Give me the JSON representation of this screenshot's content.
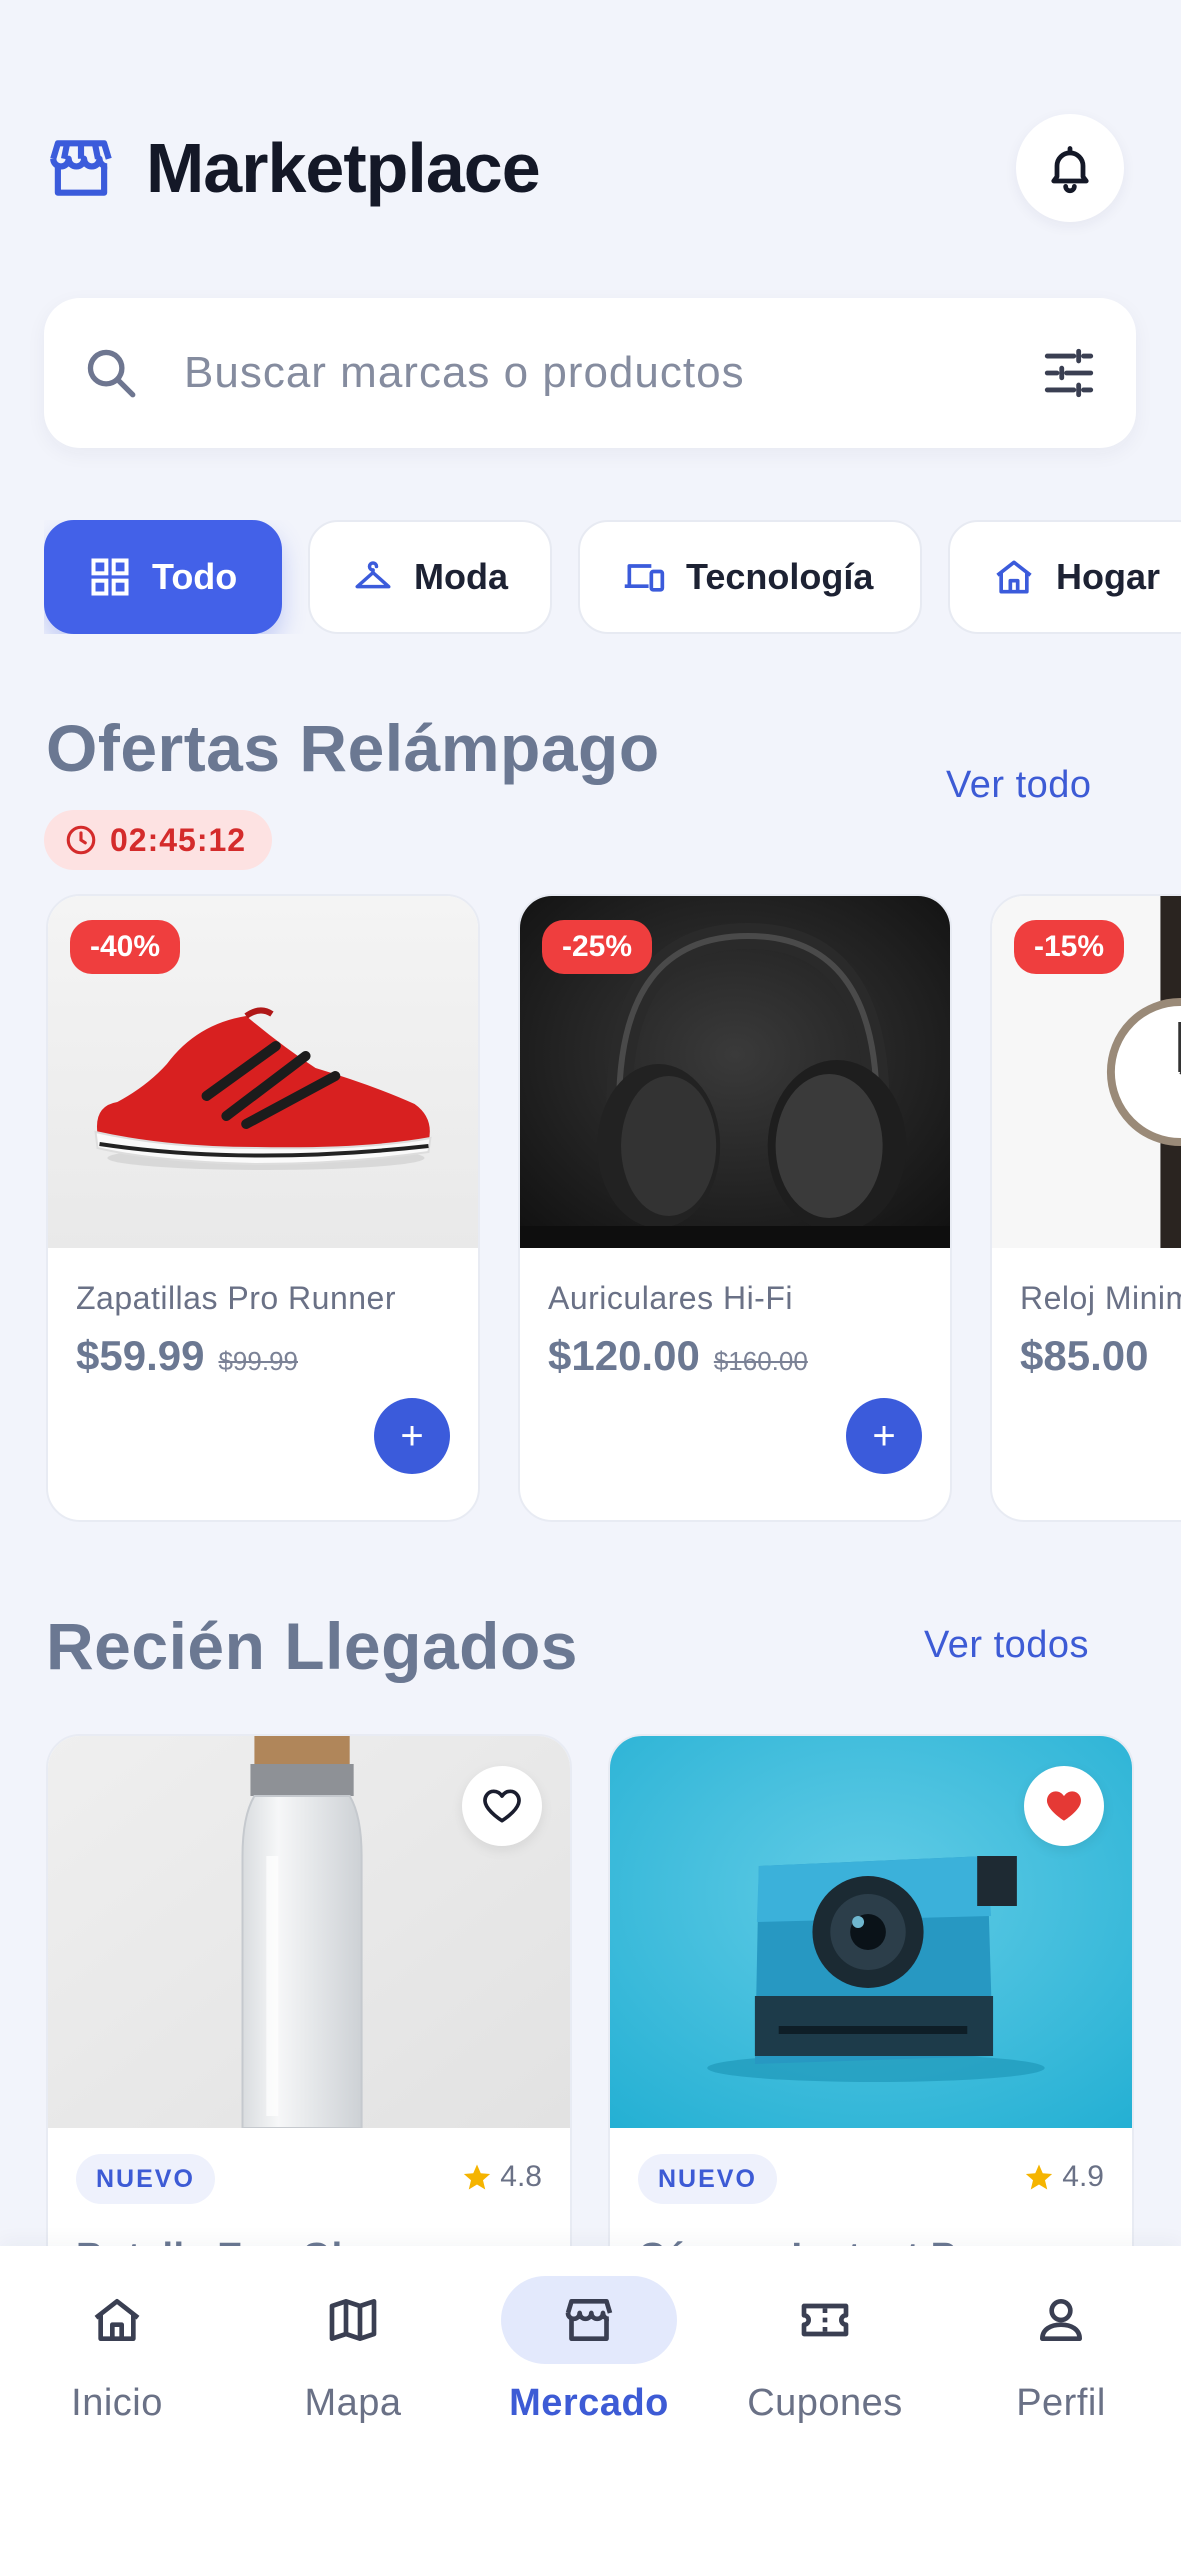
{
  "header": {
    "title": "Marketplace",
    "store_icon": "storefront-icon",
    "notifications_icon": "bell-icon"
  },
  "search": {
    "placeholder": "Buscar marcas o productos",
    "search_icon": "search-icon",
    "filter_icon": "sliders-icon"
  },
  "categories": [
    {
      "label": "Todo",
      "icon": "grid-icon",
      "active": true
    },
    {
      "label": "Moda",
      "icon": "hanger-icon",
      "active": false
    },
    {
      "label": "Tecnología",
      "icon": "devices-icon",
      "active": false
    },
    {
      "label": "Hogar",
      "icon": "home-icon",
      "active": false
    }
  ],
  "flash": {
    "title": "Ofertas Relámpago",
    "see_all": "Ver todo",
    "timer": "02:45:12",
    "items": [
      {
        "discount": "-40%",
        "name": "Zapatillas Pro Runner",
        "price": "$59.99",
        "old_price": "$99.99"
      },
      {
        "discount": "-25%",
        "name": "Auriculares Hi-Fi",
        "price": "$120.00",
        "old_price": "$160.00"
      },
      {
        "discount": "-15%",
        "name": "Reloj Minimalista",
        "price": "$85.00",
        "old_price": ""
      }
    ],
    "add_label": "+"
  },
  "arrivals": {
    "title": "Recién Llegados",
    "see_all": "Ver todos",
    "items": [
      {
        "badge": "NUEVO",
        "rating": "4.8",
        "name": "Botella Eco-Glass",
        "favorite": false
      },
      {
        "badge": "NUEVO",
        "rating": "4.9",
        "name": "Cámara Instant Pro",
        "favorite": true
      }
    ]
  },
  "nav": [
    {
      "label": "Inicio",
      "icon": "home-icon",
      "active": false
    },
    {
      "label": "Mapa",
      "icon": "map-icon",
      "active": false
    },
    {
      "label": "Mercado",
      "icon": "storefront-icon",
      "active": true
    },
    {
      "label": "Cupones",
      "icon": "ticket-icon",
      "active": false
    },
    {
      "label": "Perfil",
      "icon": "person-icon",
      "active": false
    }
  ],
  "colors": {
    "accent": "#4361E8",
    "background": "#F2F4FB",
    "discount": "#EF3E3E",
    "favorite": "#E53935",
    "star": "#F5B400"
  }
}
